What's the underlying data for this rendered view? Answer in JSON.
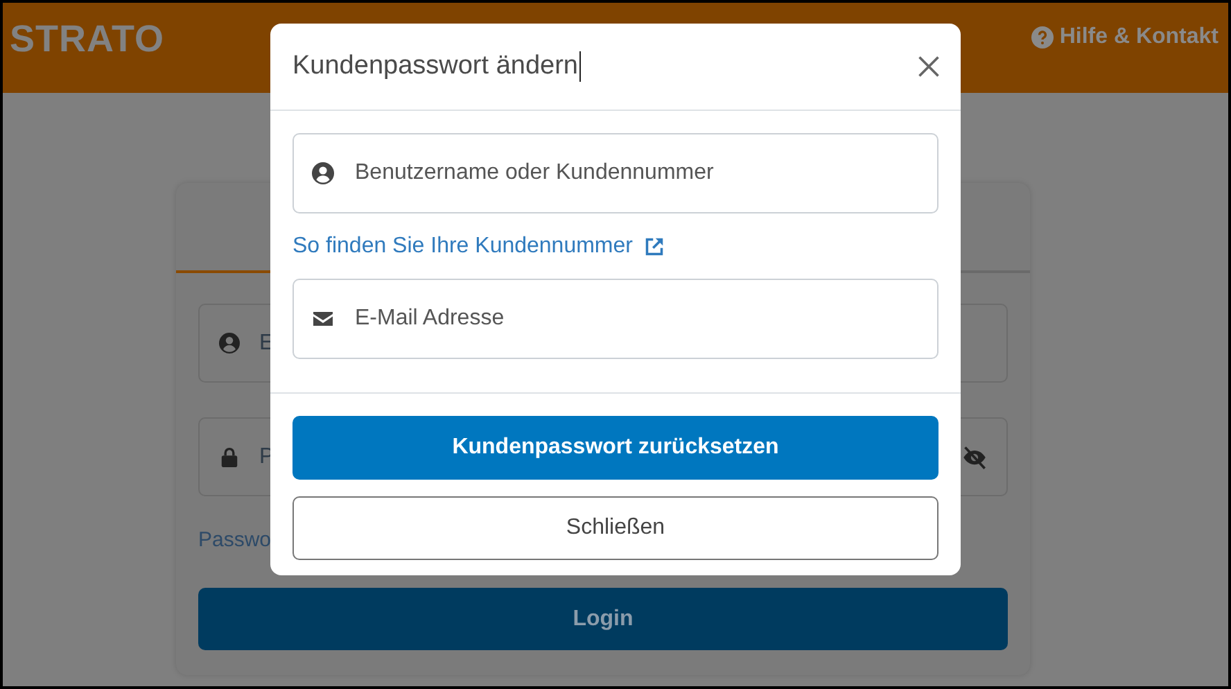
{
  "header": {
    "logo": "STRATO",
    "help_link": "Hilfe & Kontakt"
  },
  "login_card": {
    "tabs": [
      {
        "selected": true
      },
      {
        "selected": false
      }
    ],
    "fields": [
      {
        "kind": "user",
        "placeholder": "E"
      },
      {
        "kind": "lock",
        "placeholder": "P",
        "reveal_icon": true
      }
    ],
    "forgot_link": "Passwo",
    "login_button": "Login"
  },
  "modal": {
    "title": "Kundenpasswort ändern",
    "text_cursor": true,
    "fields": [
      {
        "kind": "user",
        "placeholder": "Benutzername oder Kundennummer"
      },
      {
        "kind": "mail",
        "placeholder": "E-Mail Adresse"
      }
    ],
    "help_link": "So finden Sie Ihre Kundennummer",
    "buttons": [
      {
        "kind": "primary",
        "label": "Kundenpasswort zurücksetzen"
      },
      {
        "kind": "secondary",
        "label": "Schließen"
      }
    ]
  }
}
